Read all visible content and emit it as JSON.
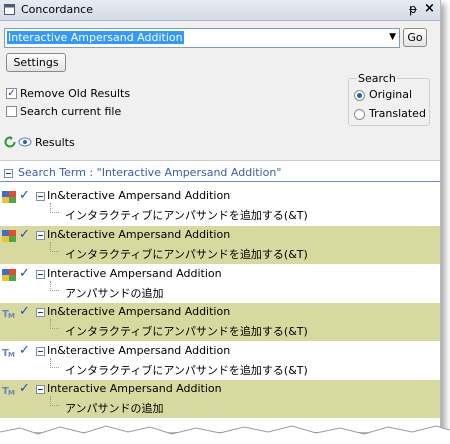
{
  "window": {
    "title": "Concordance",
    "pin_glyph": "ᵽ",
    "close_glyph": "×"
  },
  "search": {
    "value": "Interactive Ampersand Addition",
    "go_label": "Go"
  },
  "settings_label": "Settings",
  "options": {
    "remove_old": {
      "label": "Remove Old Results",
      "checked": true
    },
    "current_file": {
      "label": "Search current file",
      "checked": false
    }
  },
  "search_group": {
    "label": "Search",
    "original": {
      "label": "Original",
      "selected": true
    },
    "translated": {
      "label": "Translated",
      "selected": false
    }
  },
  "results_toolbar": {
    "label": "Results"
  },
  "results": {
    "search_term": "Search Term : \"Interactive Ampersand Addition\"",
    "items": [
      {
        "icon": "tm-color-icon",
        "source": "In&teractive Ampersand Addition",
        "target": "インタラクティブにアンパサンドを追加する(&T)",
        "highlight": false
      },
      {
        "icon": "tm-color-icon",
        "source": "In&teractive Ampersand Addition",
        "target": "インタラクティブにアンパサンドを追加する(&T)",
        "highlight": true
      },
      {
        "icon": "tm-color-icon",
        "source": "Interactive Ampersand Addition",
        "target": "アンパサンドの追加",
        "highlight": false
      },
      {
        "icon": "tm-letter-icon",
        "source": "In&teractive Ampersand Addition",
        "target": "インタラクティブにアンパサンドを追加する(&T)",
        "highlight": true
      },
      {
        "icon": "tm-letter-icon",
        "source": "In&teractive Ampersand Addition",
        "target": "インタラクティブにアンパサンドを追加する(&T)",
        "highlight": false
      },
      {
        "icon": "tm-letter-icon",
        "source": "Interactive Ampersand Addition",
        "target": "アンパサンドの追加",
        "highlight": true
      }
    ]
  },
  "colors": {
    "highlight_row": "#d8d99f",
    "accent_blue": "#3a5da8"
  }
}
